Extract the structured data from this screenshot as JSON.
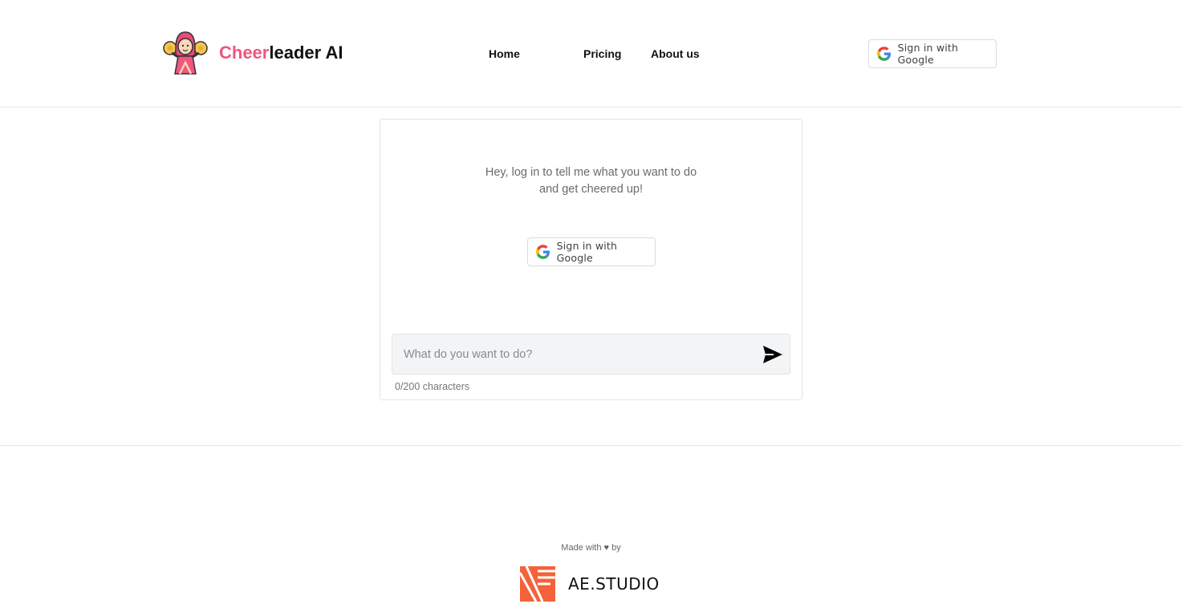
{
  "brand": {
    "name_part1": "Cheer",
    "name_part2": "leader AI"
  },
  "nav": {
    "home": "Home",
    "pricing": "Pricing",
    "about": "About us"
  },
  "header_signin": {
    "label": "Sign in with Google"
  },
  "card": {
    "message_line1": "Hey, log in to tell me what you want to do",
    "message_line2": "and get cheered up!",
    "signin_label": "Sign in with Google",
    "input_placeholder": "What do you want to do?",
    "input_value": "",
    "counter": "0/200 characters"
  },
  "footer": {
    "made_with": "Made with ♥ by",
    "studio": "AE.STUDIO"
  },
  "colors": {
    "brand_pink": "#f2557e",
    "footer_orange": "#f4623a"
  },
  "icons": {
    "logo": "cheerleader-icon",
    "google": "google-g-icon",
    "send": "send-arrow-icon",
    "studio": "ae-studio-logo"
  }
}
